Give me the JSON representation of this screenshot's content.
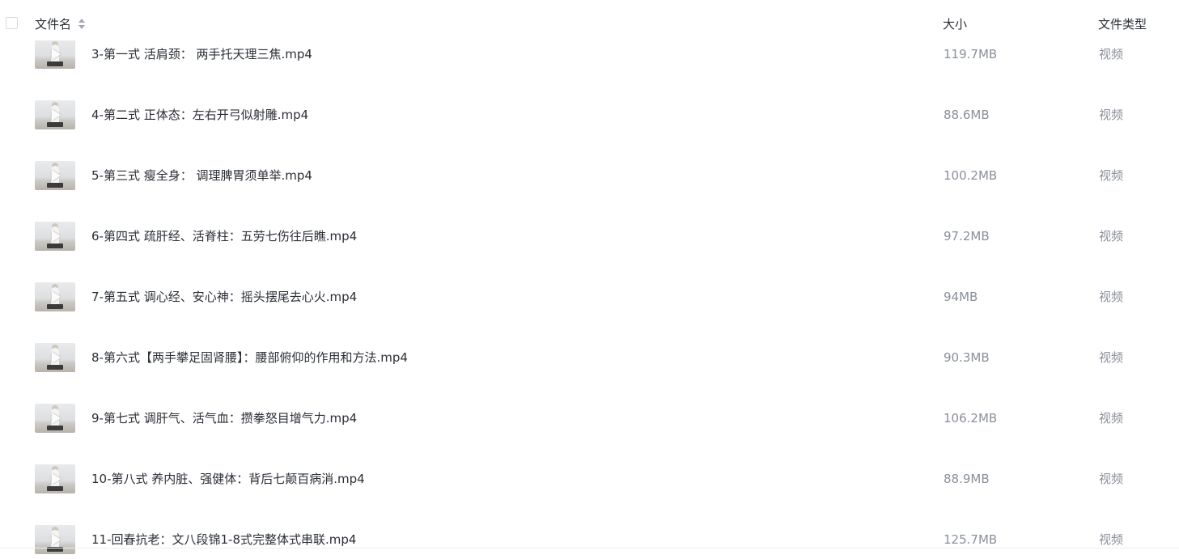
{
  "header": {
    "name_label": "文件名",
    "size_label": "大小",
    "type_label": "文件类型"
  },
  "files": [
    {
      "name": "3-第一式 活肩颈： 两手托天理三焦.mp4",
      "size": "119.7MB",
      "type": "视频"
    },
    {
      "name": "4-第二式 正体态：左右开弓似射雕.mp4",
      "size": "88.6MB",
      "type": "视频"
    },
    {
      "name": "5-第三式 瘦全身： 调理脾胃须单举.mp4",
      "size": "100.2MB",
      "type": "视频"
    },
    {
      "name": "6-第四式 疏肝经、活脊柱：五劳七伤往后瞧.mp4",
      "size": "97.2MB",
      "type": "视频"
    },
    {
      "name": "7-第五式 调心经、安心神：摇头摆尾去心火.mp4",
      "size": "94MB",
      "type": "视频"
    },
    {
      "name": "8-第六式【两手攀足固肾腰】：腰部俯仰的作用和方法.mp4",
      "size": "90.3MB",
      "type": "视频"
    },
    {
      "name": "9-第七式 调肝气、活气血：攒拳怒目增气力.mp4",
      "size": "106.2MB",
      "type": "视频"
    },
    {
      "name": "10-第八式 养内脏、强健体：背后七颠百病消.mp4",
      "size": "88.9MB",
      "type": "视频"
    },
    {
      "name": "11-回春抗老：文八段锦1-8式完整体式串联.mp4",
      "size": "125.7MB",
      "type": "视频"
    }
  ],
  "icons": {
    "sort": "sort-icon",
    "checkbox": "checkbox-icon",
    "play": "play-icon"
  },
  "colors": {
    "text_primary": "#2b2f36",
    "text_secondary": "#8a8f99",
    "border": "#d6d9de"
  }
}
